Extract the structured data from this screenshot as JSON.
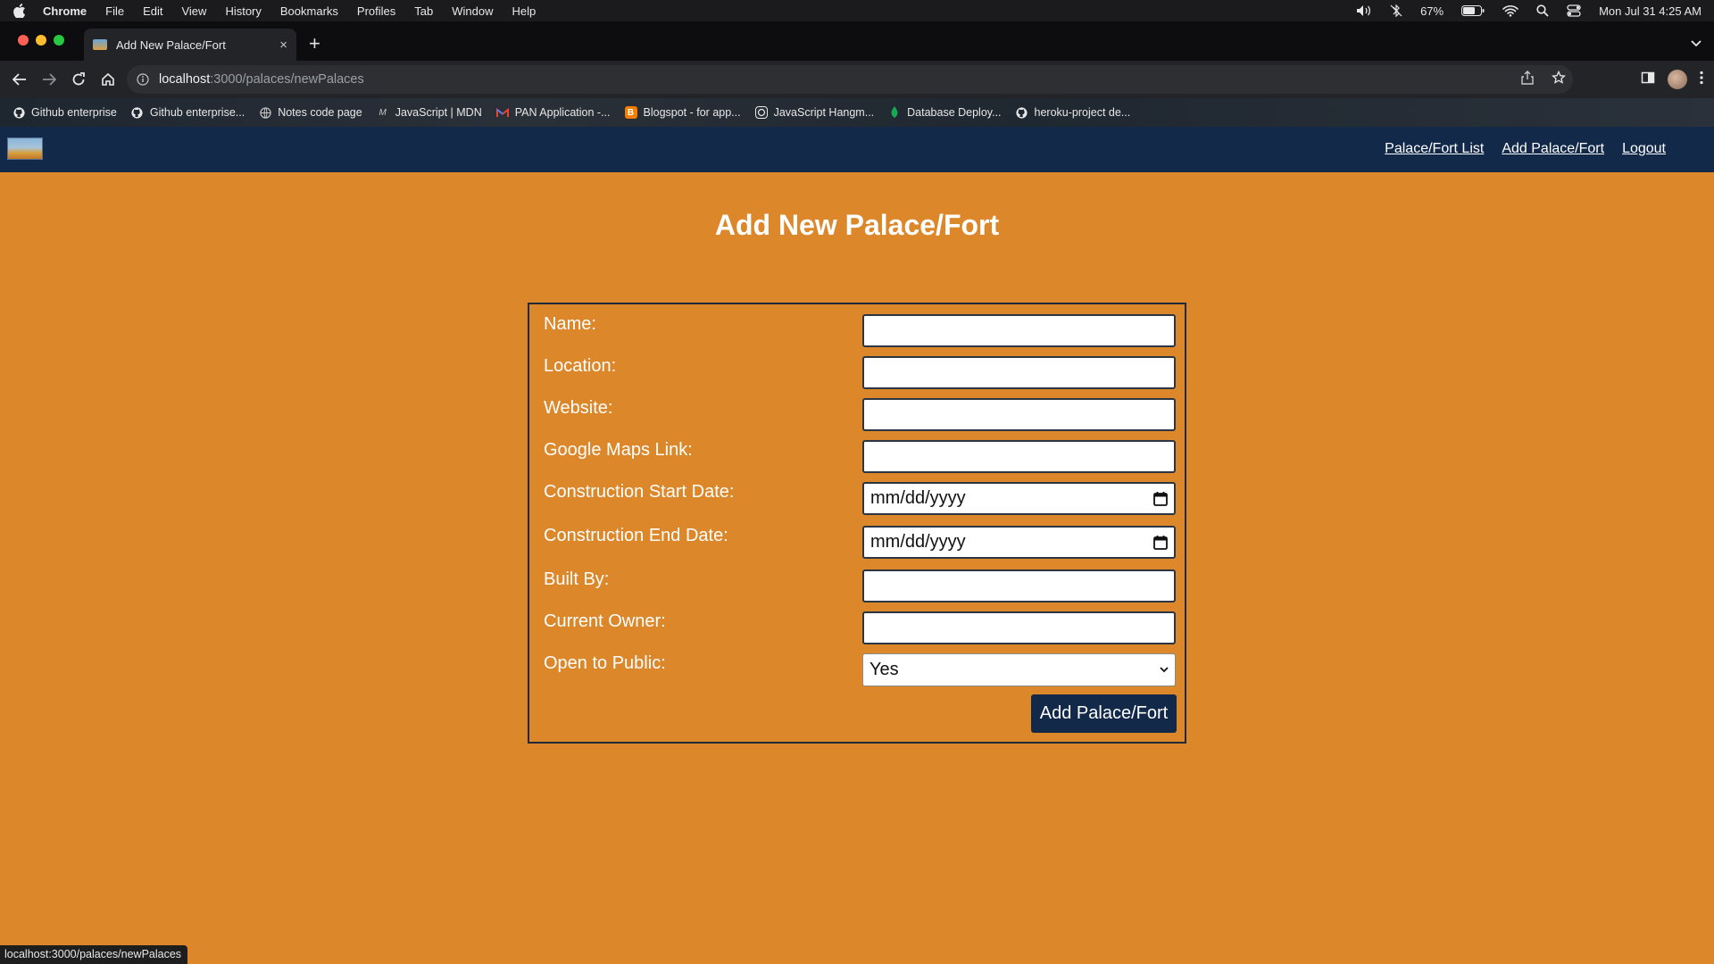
{
  "menubar": {
    "app": "Chrome",
    "items": [
      "File",
      "Edit",
      "View",
      "History",
      "Bookmarks",
      "Profiles",
      "Tab",
      "Window",
      "Help"
    ],
    "battery": "67%",
    "datetime": "Mon Jul 31  4:25 AM"
  },
  "tab": {
    "title": "Add New Palace/Fort",
    "close": "×",
    "new_tab": "+"
  },
  "omnibox": {
    "host": "localhost",
    "path": ":3000/palaces/newPalaces"
  },
  "bookmarks": [
    {
      "label": "Github enterprise",
      "icon": "github-icon"
    },
    {
      "label": "Github enterprise...",
      "icon": "github-icon"
    },
    {
      "label": "Notes code page",
      "icon": "globe-icon"
    },
    {
      "label": "JavaScript | MDN",
      "icon": "mdn-icon"
    },
    {
      "label": "PAN Application -...",
      "icon": "gmail-icon"
    },
    {
      "label": "Blogspot - for app...",
      "icon": "blogger-icon"
    },
    {
      "label": "JavaScript Hangm...",
      "icon": "chatgpt-icon"
    },
    {
      "label": "Database Deploy...",
      "icon": "mongodb-icon"
    },
    {
      "label": "heroku-project de...",
      "icon": "github-icon"
    }
  ],
  "navbar": {
    "links": [
      "Palace/Fort List",
      "Add Palace/Fort",
      "Logout"
    ]
  },
  "page_title": "Add New Palace/Fort",
  "form": {
    "fields": [
      {
        "label": "Name:",
        "value": "",
        "type": "text"
      },
      {
        "label": "Location:",
        "value": "",
        "type": "text"
      },
      {
        "label": "Website:",
        "value": "",
        "type": "text"
      },
      {
        "label": "Google Maps Link:",
        "value": "",
        "type": "text"
      },
      {
        "label": "Construction Start Date:",
        "value": "mm/dd/yyyy",
        "type": "date"
      },
      {
        "label": "Construction End Date:",
        "value": "mm/dd/yyyy",
        "type": "date"
      },
      {
        "label": "Built By:",
        "value": "",
        "type": "text"
      },
      {
        "label": "Current Owner:",
        "value": "",
        "type": "text"
      },
      {
        "label": "Open to Public:",
        "value": "Yes",
        "type": "select"
      }
    ],
    "submit_label": "Add Palace/Fort"
  },
  "status_url": "localhost:3000/palaces/newPalaces",
  "colors": {
    "page_bg": "#dc872a",
    "navbar_bg": "#12294a",
    "button_bg": "#12294a"
  }
}
